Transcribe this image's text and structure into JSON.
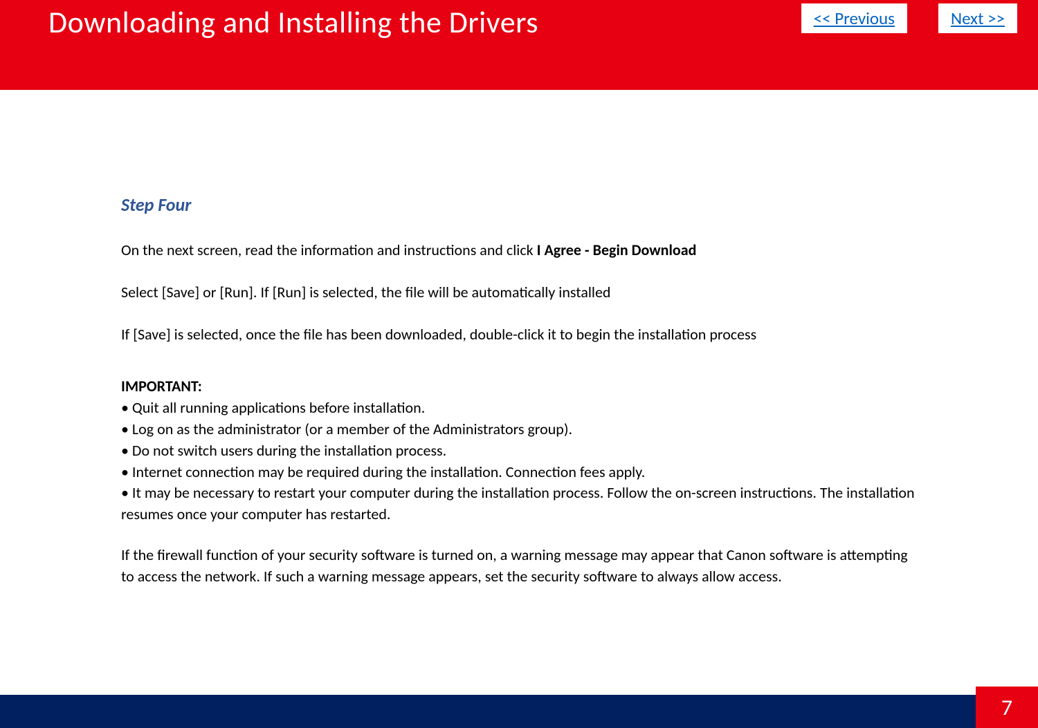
{
  "header": {
    "title": "Downloading and Installing  the Drivers",
    "prev_label": " << Previous",
    "next_label": "Next >>"
  },
  "content": {
    "step_title": "Step Four",
    "para1_prefix": "On the next screen, read the information and instructions and click ",
    "para1_bold": "I Agree - Begin Download",
    "para2": "Select [Save] or [Run].  If [Run] is selected, the file will be automatically installed",
    "para3": "If [Save] is selected, once the file has been downloaded, double-click it to begin the installation process",
    "important_label": "IMPORTANT:",
    "bullets": [
      "• Quit all running applications before installation.",
      "• Log on as the administrator (or a member of the Administrators group).",
      "• Do not switch users during the installation process.",
      "• Internet connection may be required during the installation. Connection fees apply.",
      "• It may be necessary to restart your computer during the installation process. Follow the on-screen instructions. The installation resumes once your computer has restarted."
    ],
    "firewall": "If the firewall function of your security software is turned on, a warning message may appear that Canon software is attempting to access the network. If such a warning message appears, set the security software to always allow access."
  },
  "footer": {
    "page_number": "7"
  }
}
